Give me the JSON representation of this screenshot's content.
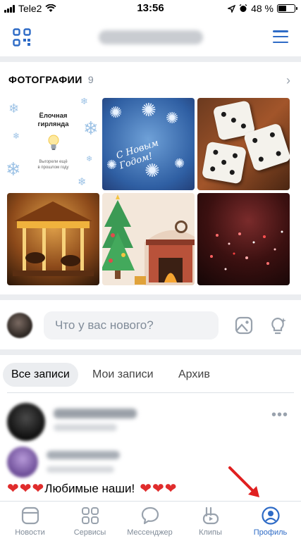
{
  "status_bar": {
    "carrier": "Tele2",
    "time": "13:56",
    "battery": "48 %",
    "battery_level": 0.48
  },
  "header": {
    "qr_icon": "qr-code-icon",
    "menu_icon": "hamburger-menu-icon"
  },
  "photos": {
    "title": "ФОТОГРАФИИ",
    "count": "9",
    "chevron_icon": "chevron-right-icon",
    "garland": {
      "title": "Ёлочная\nгирлянда",
      "subtitle": "Выгорели ещё\nв прошлом году"
    },
    "fireworks_greeting": "С Новым Годом!"
  },
  "composer": {
    "placeholder": "Что у вас нового?",
    "photo_icon": "image-icon",
    "idea_icon": "lightbulb-icon"
  },
  "tabs": [
    {
      "label": "Все записи",
      "active": true
    },
    {
      "label": "Мои записи",
      "active": false
    },
    {
      "label": "Архив",
      "active": false
    }
  ],
  "post": {
    "text": "Любимые наши!",
    "more_icon": "more-horizontal-icon"
  },
  "bottom_nav": [
    {
      "label": "Новости",
      "icon": "news-icon",
      "active": false
    },
    {
      "label": "Сервисы",
      "icon": "services-icon",
      "active": false
    },
    {
      "label": "Мессенджер",
      "icon": "messenger-icon",
      "active": false
    },
    {
      "label": "Клипы",
      "icon": "clips-icon",
      "active": false
    },
    {
      "label": "Профиль",
      "icon": "profile-icon",
      "active": true
    }
  ],
  "colors": {
    "accent": "#2e6bc6",
    "muted": "#818c99",
    "divider": "#ebedf0",
    "heart": "#e02c2c",
    "annotation_arrow": "#e02020"
  }
}
